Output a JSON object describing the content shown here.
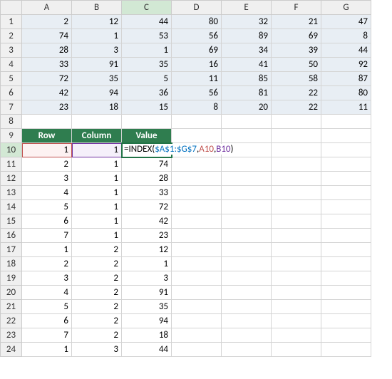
{
  "columns": [
    "A",
    "B",
    "C",
    "D",
    "E",
    "F",
    "G"
  ],
  "dataGrid": [
    [
      2,
      12,
      44,
      80,
      32,
      21,
      47
    ],
    [
      74,
      1,
      53,
      56,
      89,
      69,
      8
    ],
    [
      28,
      3,
      1,
      69,
      34,
      39,
      44
    ],
    [
      33,
      91,
      35,
      16,
      41,
      50,
      92
    ],
    [
      72,
      35,
      5,
      11,
      85,
      58,
      87
    ],
    [
      42,
      94,
      36,
      56,
      81,
      22,
      80
    ],
    [
      23,
      18,
      15,
      8,
      20,
      22,
      11
    ]
  ],
  "headerRow": {
    "a": "Row",
    "b": "Column",
    "c": "Value"
  },
  "formula": {
    "prefix": "=INDEX(",
    "range": "$A$1:$G$7",
    "sep1": ",",
    "ref1": "A10",
    "sep2": ",",
    "ref2": "B10",
    "suffix": ")"
  },
  "resultRows": [
    {
      "r": 1,
      "c": 1,
      "v": ""
    },
    {
      "r": 2,
      "c": 1,
      "v": 74
    },
    {
      "r": 3,
      "c": 1,
      "v": 28
    },
    {
      "r": 4,
      "c": 1,
      "v": 33
    },
    {
      "r": 5,
      "c": 1,
      "v": 72
    },
    {
      "r": 6,
      "c": 1,
      "v": 42
    },
    {
      "r": 7,
      "c": 1,
      "v": 23
    },
    {
      "r": 1,
      "c": 2,
      "v": 12
    },
    {
      "r": 2,
      "c": 2,
      "v": 1
    },
    {
      "r": 3,
      "c": 2,
      "v": 3
    },
    {
      "r": 4,
      "c": 2,
      "v": 91
    },
    {
      "r": 5,
      "c": 2,
      "v": 35
    },
    {
      "r": 6,
      "c": 2,
      "v": 94
    },
    {
      "r": 7,
      "c": 2,
      "v": 18
    },
    {
      "r": 1,
      "c": 3,
      "v": 44
    }
  ],
  "chart_data": {
    "type": "table",
    "title": "INDEX formula demonstration",
    "source_range": "A1:G7",
    "lookup_columns": [
      "Row",
      "Column",
      "Value"
    ],
    "formula": "=INDEX($A$1:$G$7,A10,B10)"
  }
}
